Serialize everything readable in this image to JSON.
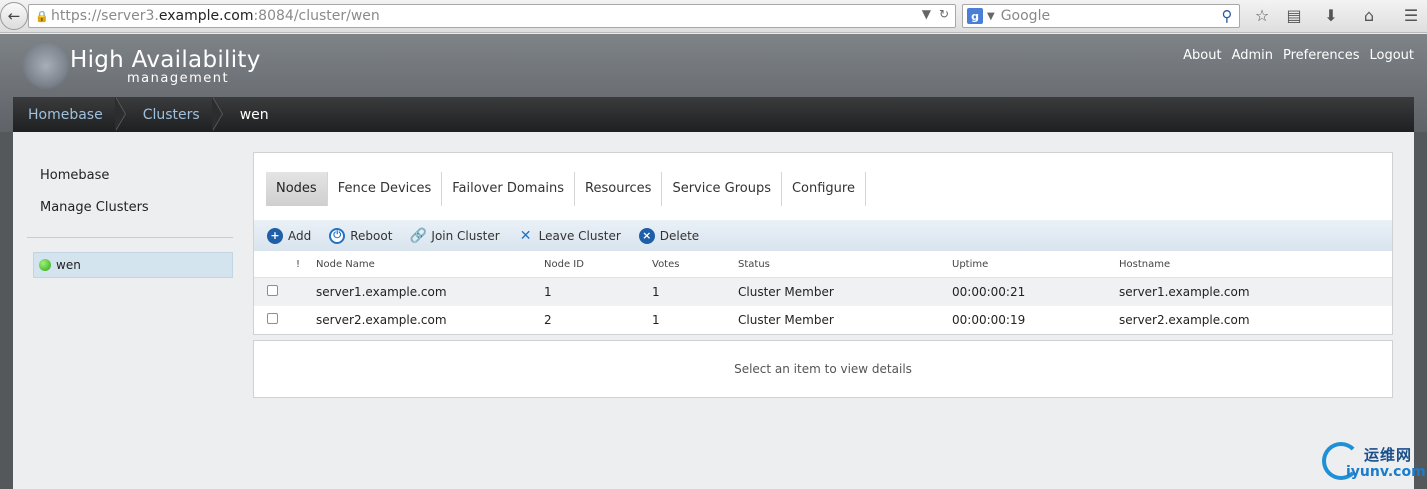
{
  "browser": {
    "url_prefix": "https://server3.",
    "url_host": "example.com",
    "url_suffix": ":8084/cluster/wen",
    "search_placeholder": "Google"
  },
  "header": {
    "title": "High Availability",
    "subtitle": "management",
    "links": [
      "About",
      "Admin",
      "Preferences",
      "Logout"
    ]
  },
  "breadcrumb": {
    "items": [
      "Homebase",
      "Clusters"
    ],
    "current": "wen"
  },
  "sidebar": {
    "links": [
      "Homebase",
      "Manage Clusters"
    ],
    "cluster": {
      "name": "wen",
      "status_color": "#3cc21c"
    }
  },
  "tabs": [
    "Nodes",
    "Fence Devices",
    "Failover Domains",
    "Resources",
    "Service Groups",
    "Configure"
  ],
  "active_tab": "Nodes",
  "toolbar": {
    "add": "Add",
    "reboot": "Reboot",
    "join": "Join Cluster",
    "leave": "Leave Cluster",
    "delete": "Delete"
  },
  "table": {
    "columns": {
      "bang": "!",
      "name": "Node Name",
      "id": "Node ID",
      "votes": "Votes",
      "status": "Status",
      "uptime": "Uptime",
      "hostname": "Hostname"
    },
    "rows": [
      {
        "name": "server1.example.com",
        "id": "1",
        "votes": "1",
        "status": "Cluster Member",
        "uptime": "00:00:00:21",
        "hostname": "server1.example.com"
      },
      {
        "name": "server2.example.com",
        "id": "2",
        "votes": "1",
        "status": "Cluster Member",
        "uptime": "00:00:00:19",
        "hostname": "server2.example.com"
      }
    ]
  },
  "details": {
    "message": "Select an item to view details"
  },
  "watermark": {
    "cn": "运维网",
    "en": "iyunv.com"
  }
}
